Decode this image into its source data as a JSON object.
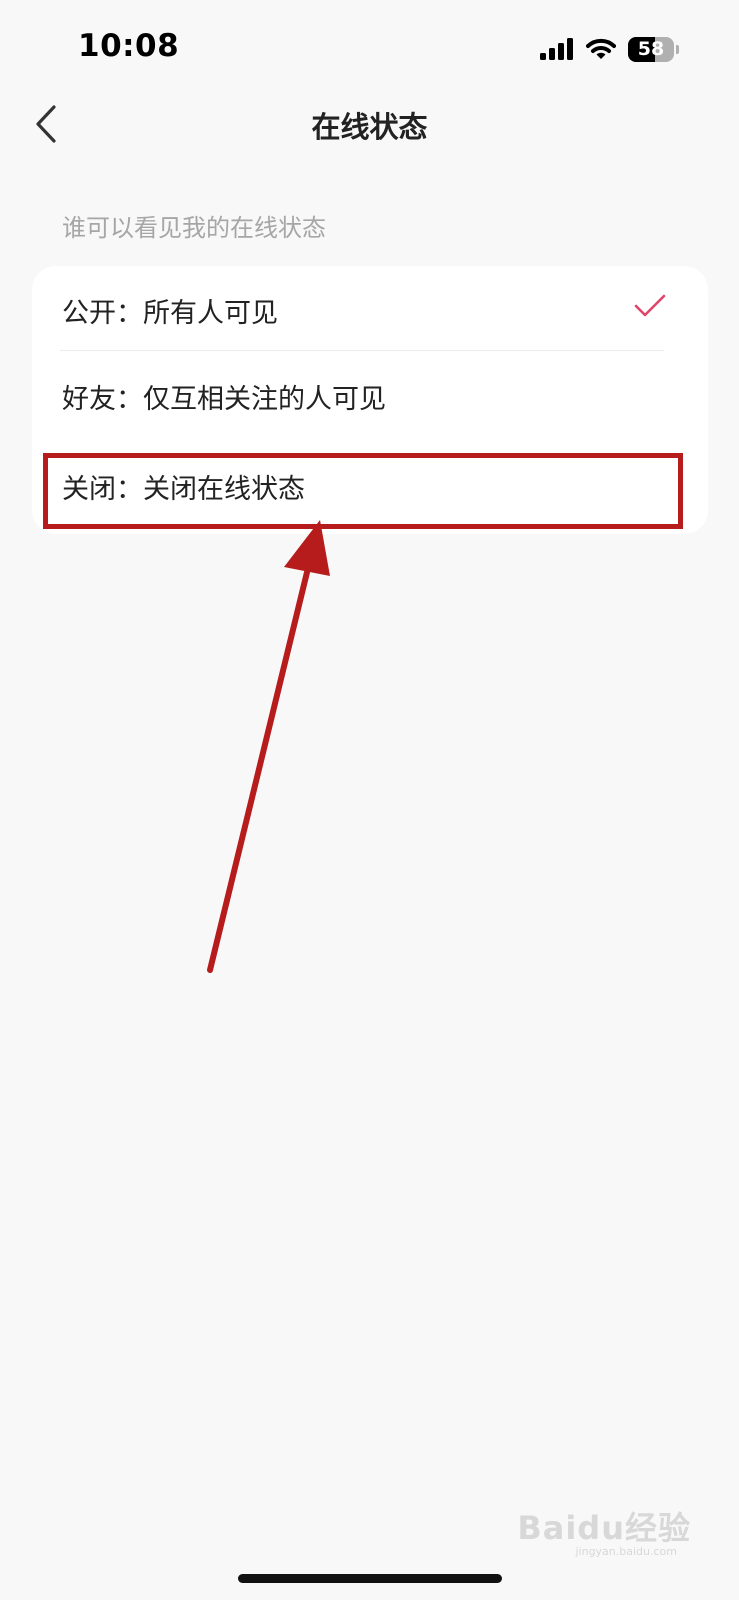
{
  "status_bar": {
    "time": "10:08",
    "battery": "58"
  },
  "nav": {
    "title": "在线状态"
  },
  "section": {
    "header": "谁可以看见我的在线状态"
  },
  "options": [
    {
      "label": "公开：所有人可见",
      "selected": true
    },
    {
      "label": "好友：仅互相关注的人可见",
      "selected": false
    },
    {
      "label": "关闭：关闭在线状态",
      "selected": false
    }
  ],
  "watermark": {
    "text": "Baidu经验",
    "url": "jingyan.baidu.com"
  },
  "colors": {
    "accent": "#e0456a",
    "annotation": "#b71c1c",
    "background": "#f8f8f8"
  },
  "icons": [
    "cellular-signal-icon",
    "wifi-icon",
    "battery-icon",
    "back-chevron-icon",
    "checkmark-icon"
  ]
}
